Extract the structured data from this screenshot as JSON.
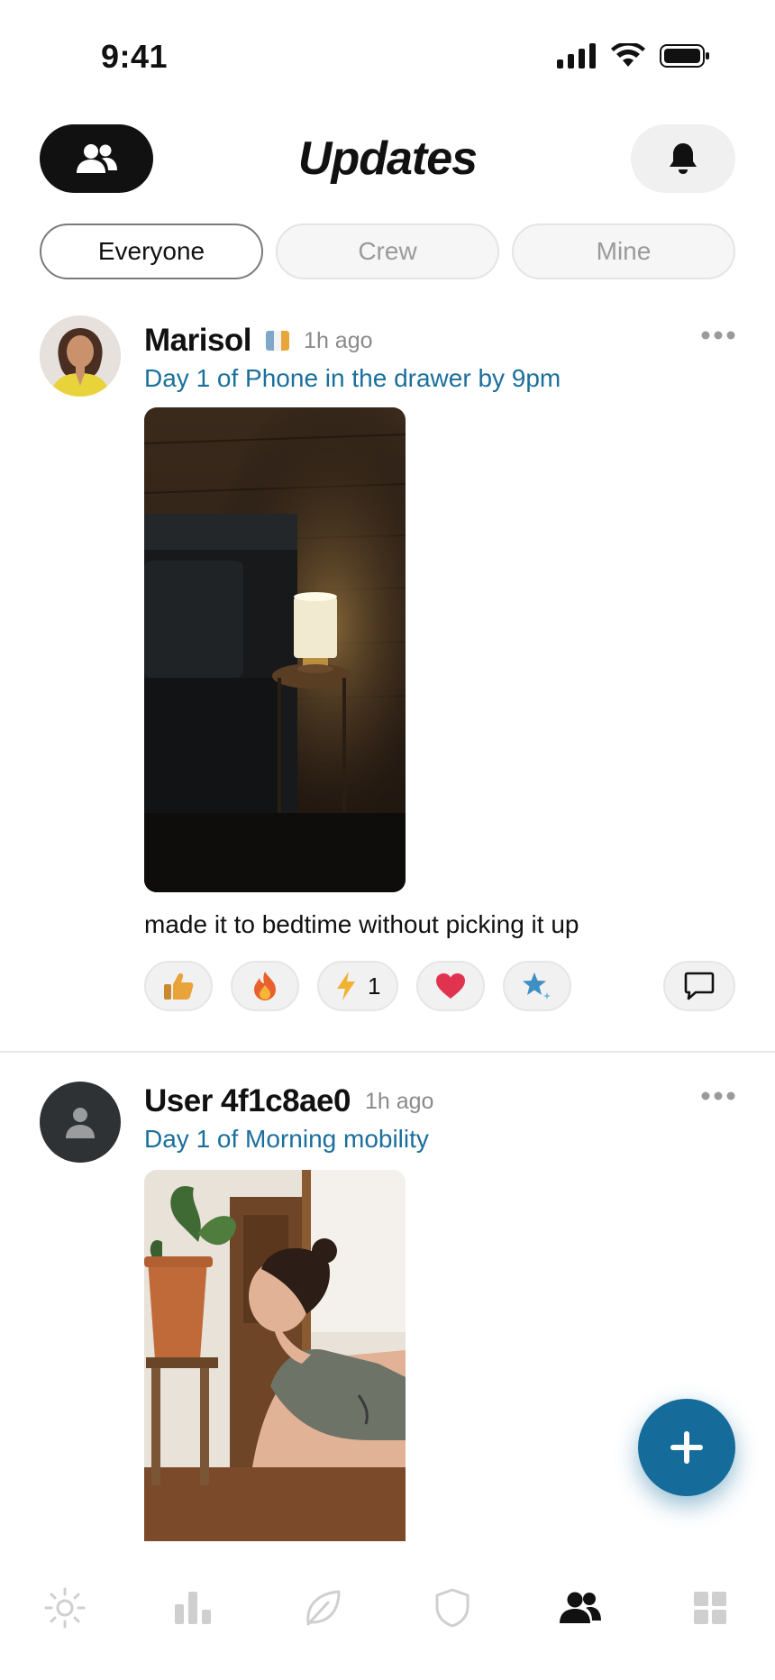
{
  "status": {
    "time": "9:41"
  },
  "header": {
    "title": "Updates"
  },
  "filters": [
    {
      "label": "Everyone",
      "active": true
    },
    {
      "label": "Crew",
      "active": false
    },
    {
      "label": "Mine",
      "active": false
    }
  ],
  "posts": [
    {
      "username": "Marisol",
      "time": "1h ago",
      "challenge": "Day 1 of Phone in the drawer by 9pm",
      "caption": "made it to bedtime without picking it up",
      "reactions": [
        {
          "icon": "thumbs-up-icon",
          "count": ""
        },
        {
          "icon": "fire-icon",
          "count": ""
        },
        {
          "icon": "lightning-icon",
          "count": "1"
        },
        {
          "icon": "heart-icon",
          "count": ""
        },
        {
          "icon": "star-icon",
          "count": ""
        }
      ]
    },
    {
      "username": "User 4f1c8ae0",
      "time": "1h ago",
      "challenge": "Day 1 of Morning mobility"
    }
  ],
  "tabbar": {
    "items": [
      "sun-icon",
      "bar-chart-icon",
      "leaf-icon",
      "shield-icon",
      "people-icon",
      "grid-icon"
    ],
    "active": "people-icon"
  },
  "colors": {
    "accent": "#1b6f9c",
    "fab": "#156c9b",
    "dark": "#111111"
  }
}
